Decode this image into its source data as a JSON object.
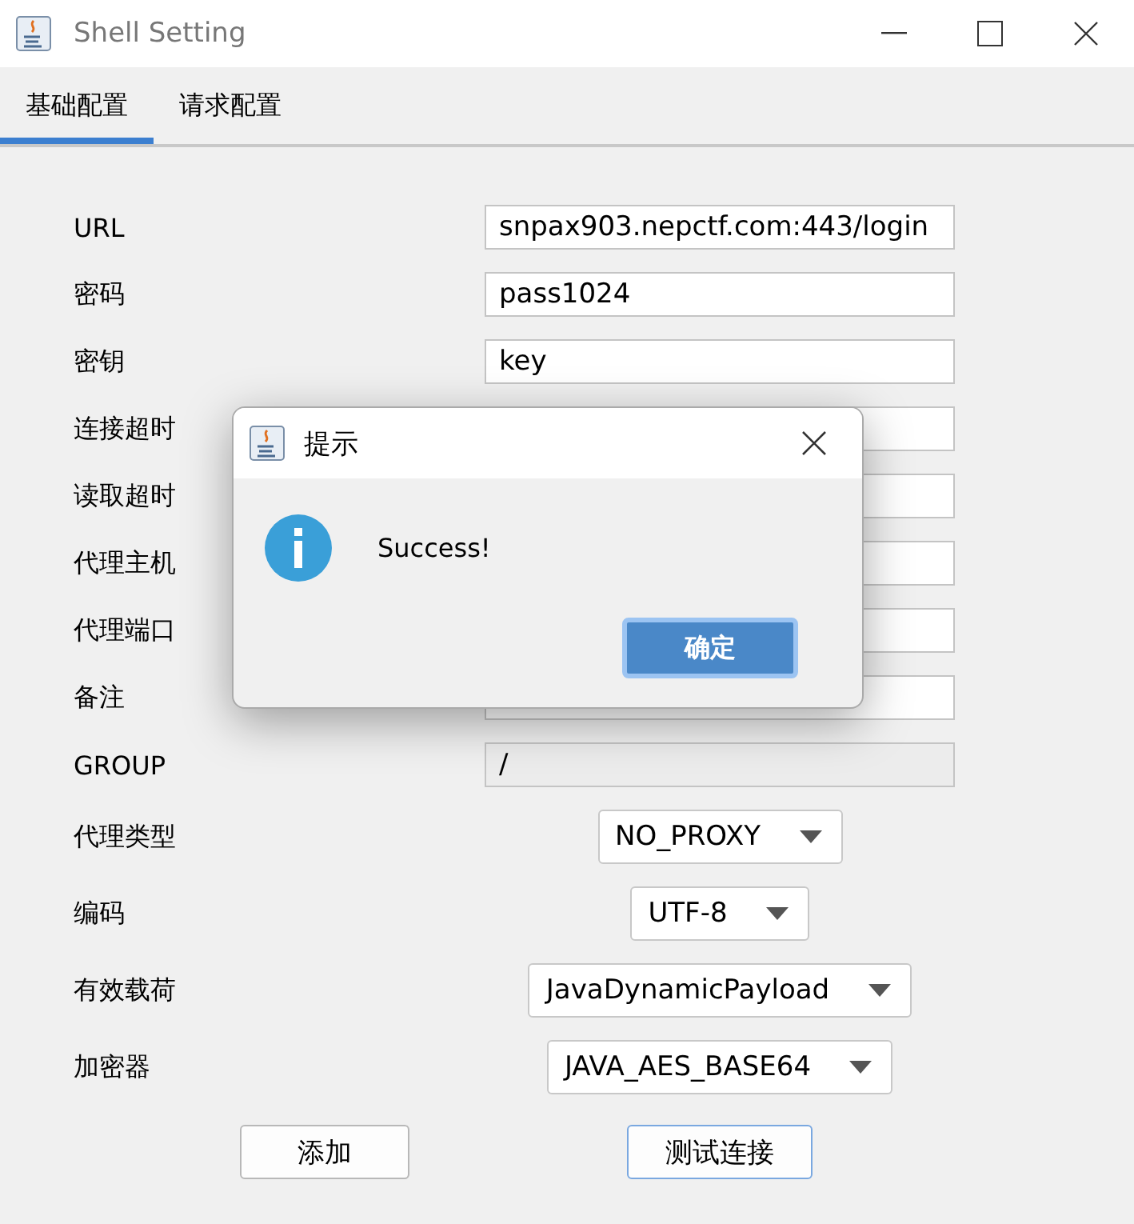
{
  "window": {
    "title": "Shell Setting"
  },
  "tabs": [
    {
      "label": "基础配置",
      "selected": true
    },
    {
      "label": "请求配置",
      "selected": false
    }
  ],
  "fields": [
    {
      "label": "URL",
      "kind": "text",
      "value": "snpax903.nepctf.com:443/login",
      "disabled": false
    },
    {
      "label": "密码",
      "kind": "text",
      "value": "pass1024",
      "disabled": false
    },
    {
      "label": "密钥",
      "kind": "text",
      "value": "key",
      "disabled": false
    },
    {
      "label": "连接超时",
      "kind": "text",
      "disabled": false
    },
    {
      "label": "读取超时",
      "kind": "text",
      "disabled": false
    },
    {
      "label": "代理主机",
      "kind": "text",
      "disabled": false
    },
    {
      "label": "代理端口",
      "kind": "text",
      "disabled": false
    },
    {
      "label": "备注",
      "kind": "text",
      "disabled": false
    },
    {
      "label": "GROUP",
      "kind": "text",
      "value": "/",
      "disabled": true
    },
    {
      "label": "代理类型",
      "kind": "combo",
      "value": "NO_PROXY"
    },
    {
      "label": "编码",
      "kind": "combo",
      "value": "UTF-8"
    },
    {
      "label": "有效载荷",
      "kind": "combo",
      "value": "JavaDynamicPayload"
    },
    {
      "label": "加密器",
      "kind": "combo",
      "value": "JAVA_AES_BASE64"
    }
  ],
  "buttons": [
    {
      "label": "添加",
      "focused": false
    },
    {
      "label": "测试连接",
      "focused": true
    }
  ],
  "dialog": {
    "title": "提示",
    "message": "Success!",
    "button": "确定"
  }
}
